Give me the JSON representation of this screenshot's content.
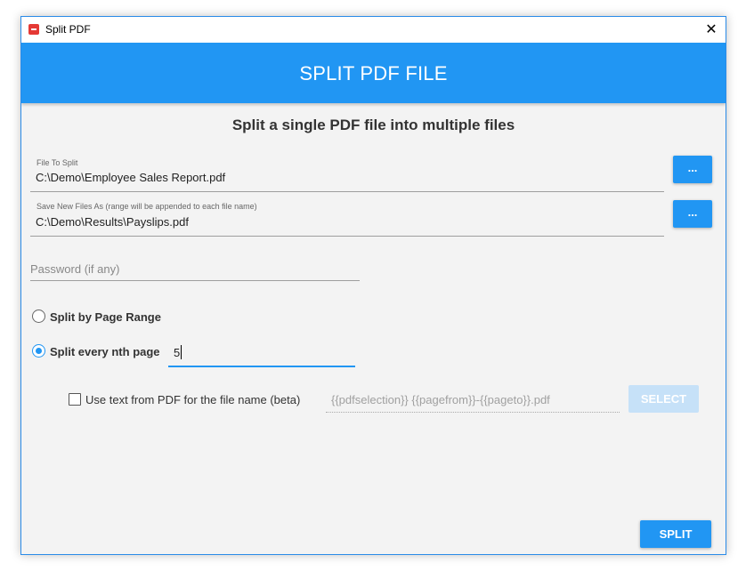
{
  "window": {
    "title": "Split PDF",
    "close_glyph": "✕"
  },
  "banner": {
    "title": "SPLIT PDF FILE"
  },
  "main": {
    "subtitle": "Split a single PDF file into multiple files",
    "file_to_split": {
      "label": "File To Split",
      "value": "C:\\Demo\\Employee Sales Report.pdf",
      "browse_label": "..."
    },
    "save_as": {
      "label": "Save New Files As (range will be appended to each file name)",
      "value": "C:\\Demo\\Results\\Payslips.pdf",
      "browse_label": "..."
    },
    "password": {
      "placeholder": "Password (if any)"
    },
    "options": {
      "page_range_label": "Split by Page Range",
      "nth_page_label": "Split every nth page",
      "nth_value": "5"
    },
    "filename_from_text": {
      "checkbox_label": "Use text from PDF for the file name (beta)",
      "template": "{{pdfselection}} {{pagefrom}}-{{pageto}}.pdf",
      "select_label": "SELECT"
    },
    "split_label": "SPLIT"
  },
  "colors": {
    "accent": "#2196f3",
    "disabled_button": "#c6e1f8"
  }
}
